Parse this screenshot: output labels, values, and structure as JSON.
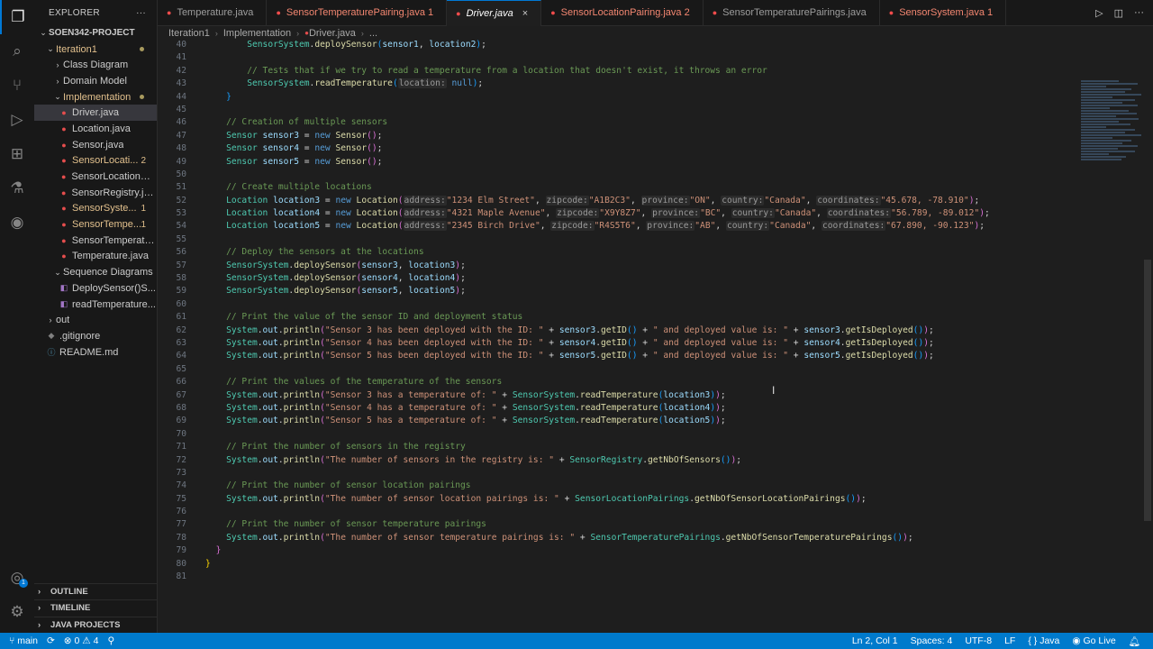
{
  "sidebar": {
    "title": "EXPLORER",
    "more": "···",
    "items": [
      {
        "label": "SOEN342-PROJECT",
        "chev": "⌄",
        "indent": 4,
        "bold": true,
        "cls": ""
      },
      {
        "label": "Iteration1",
        "chev": "⌄",
        "indent": 12,
        "cls": "mod",
        "dot": true
      },
      {
        "label": "Class Diagram",
        "chev": "›",
        "indent": 20,
        "cls": ""
      },
      {
        "label": "Domain Model",
        "chev": "›",
        "indent": 20,
        "cls": ""
      },
      {
        "label": "Implementation",
        "chev": "⌄",
        "indent": 20,
        "cls": "mod",
        "dot": true
      },
      {
        "label": "Driver.java",
        "icon": "java",
        "indent": 26,
        "cls": "",
        "selected": true
      },
      {
        "label": "Location.java",
        "icon": "java",
        "indent": 26,
        "cls": ""
      },
      {
        "label": "Sensor.java",
        "icon": "java",
        "indent": 26,
        "cls": ""
      },
      {
        "label": "SensorLocati...",
        "icon": "java",
        "indent": 26,
        "cls": "mod",
        "badge": "2"
      },
      {
        "label": "SensorLocationPa...",
        "icon": "java",
        "indent": 26,
        "cls": ""
      },
      {
        "label": "SensorRegistry.java",
        "icon": "java",
        "indent": 26,
        "cls": ""
      },
      {
        "label": "SensorSyste...",
        "icon": "java",
        "indent": 26,
        "cls": "mod",
        "badge": "1"
      },
      {
        "label": "SensorTempe...",
        "icon": "java",
        "indent": 26,
        "cls": "mod",
        "badge": "1"
      },
      {
        "label": "SensorTemperatu...",
        "icon": "java",
        "indent": 26,
        "cls": ""
      },
      {
        "label": "Temperature.java",
        "icon": "java",
        "indent": 26,
        "cls": ""
      },
      {
        "label": "Sequence Diagrams",
        "chev": "⌄",
        "indent": 20,
        "cls": ""
      },
      {
        "label": "DeploySensor()S...",
        "icon": "diagram",
        "indent": 26,
        "cls": ""
      },
      {
        "label": "readTemperature...",
        "icon": "diagram",
        "indent": 26,
        "cls": ""
      },
      {
        "label": "out",
        "chev": "›",
        "indent": 12,
        "cls": ""
      },
      {
        "label": ".gitignore",
        "icon": "git",
        "indent": 12,
        "cls": ""
      },
      {
        "label": "README.md",
        "icon": "info",
        "indent": 12,
        "cls": ""
      }
    ],
    "sections": [
      "OUTLINE",
      "TIMELINE",
      "JAVA PROJECTS"
    ]
  },
  "tabs": [
    {
      "label": "Temperature.java",
      "cls": ""
    },
    {
      "label": "SensorTemperaturePairing.java 1",
      "cls": "errt"
    },
    {
      "label": "Driver.java",
      "cls": "active"
    },
    {
      "label": "SensorLocationPairing.java 2",
      "cls": "errt"
    },
    {
      "label": "SensorTemperaturePairings.java",
      "cls": ""
    },
    {
      "label": "SensorSystem.java 1",
      "cls": "errt"
    }
  ],
  "breadcrumb": [
    "Iteration1",
    "Implementation",
    "Driver.java",
    "..."
  ],
  "code": [
    {
      "n": 40,
      "h": "        <span class='t'>SensorSystem</span><span class='p'>.</span><span class='f'>deploySensor</span><span class='b3'>(</span><span class='v'>sensor1</span><span class='p'>, </span><span class='v'>location2</span><span class='b3'>)</span><span class='p'>;</span>"
    },
    {
      "n": 41,
      "h": ""
    },
    {
      "n": 42,
      "h": "        <span class='c'>// Tests that if we try to read a temperature from a location that doesn't exist, it throws an error</span>"
    },
    {
      "n": 43,
      "h": "        <span class='t'>SensorSystem</span><span class='p'>.</span><span class='f'>readTemperature</span><span class='b3'>(</span><span class='hint'>location:</span> <span class='k'>null</span><span class='b3'>)</span><span class='p'>;</span>"
    },
    {
      "n": 44,
      "h": "    <span class='b3'>}</span>"
    },
    {
      "n": 45,
      "h": ""
    },
    {
      "n": 46,
      "h": "    <span class='c'>// Creation of multiple sensors</span>"
    },
    {
      "n": 47,
      "h": "    <span class='t'>Sensor</span> <span class='v'>sensor3</span> <span class='p'>=</span> <span class='k'>new</span> <span class='f'>Sensor</span><span class='b2'>()</span><span class='p'>;</span>"
    },
    {
      "n": 48,
      "h": "    <span class='t'>Sensor</span> <span class='v'>sensor4</span> <span class='p'>=</span> <span class='k'>new</span> <span class='f'>Sensor</span><span class='b2'>()</span><span class='p'>;</span>"
    },
    {
      "n": 49,
      "h": "    <span class='t'>Sensor</span> <span class='v'>sensor5</span> <span class='p'>=</span> <span class='k'>new</span> <span class='f'>Sensor</span><span class='b2'>()</span><span class='p'>;</span>"
    },
    {
      "n": 50,
      "h": ""
    },
    {
      "n": 51,
      "h": "    <span class='c'>// Create multiple locations</span>"
    },
    {
      "n": 52,
      "h": "    <span class='t'>Location</span> <span class='v'>location3</span> <span class='p'>=</span> <span class='k'>new</span> <span class='f'>Location</span><span class='b2'>(</span><span class='hint'>address:</span><span class='s'>\"1234 Elm Street\"</span><span class='p'>, </span><span class='hint'>zipcode:</span><span class='s'>\"A1B2C3\"</span><span class='p'>, </span><span class='hint'>province:</span><span class='s'>\"ON\"</span><span class='p'>, </span><span class='hint'>country:</span><span class='s'>\"Canada\"</span><span class='p'>, </span><span class='hint'>coordinates:</span><span class='s'>\"45.678, -78.910\"</span><span class='b2'>)</span><span class='p'>;</span>"
    },
    {
      "n": 53,
      "h": "    <span class='t'>Location</span> <span class='v'>location4</span> <span class='p'>=</span> <span class='k'>new</span> <span class='f'>Location</span><span class='b2'>(</span><span class='hint'>address:</span><span class='s'>\"4321 Maple Avenue\"</span><span class='p'>, </span><span class='hint'>zipcode:</span><span class='s'>\"X9Y8Z7\"</span><span class='p'>, </span><span class='hint'>province:</span><span class='s'>\"BC\"</span><span class='p'>, </span><span class='hint'>country:</span><span class='s'>\"Canada\"</span><span class='p'>, </span><span class='hint'>coordinates:</span><span class='s'>\"56.789, -89.012\"</span><span class='b2'>)</span><span class='p'>;</span>"
    },
    {
      "n": 54,
      "h": "    <span class='t'>Location</span> <span class='v'>location5</span> <span class='p'>=</span> <span class='k'>new</span> <span class='f'>Location</span><span class='b2'>(</span><span class='hint'>address:</span><span class='s'>\"2345 Birch Drive\"</span><span class='p'>, </span><span class='hint'>zipcode:</span><span class='s'>\"R4S5T6\"</span><span class='p'>, </span><span class='hint'>province:</span><span class='s'>\"AB\"</span><span class='p'>, </span><span class='hint'>country:</span><span class='s'>\"Canada\"</span><span class='p'>, </span><span class='hint'>coordinates:</span><span class='s'>\"67.890, -90.123\"</span><span class='b2'>)</span><span class='p'>;</span>"
    },
    {
      "n": 55,
      "h": ""
    },
    {
      "n": 56,
      "h": "    <span class='c'>// Deploy the sensors at the locations</span>"
    },
    {
      "n": 57,
      "h": "    <span class='t'>SensorSystem</span><span class='p'>.</span><span class='f'>deploySensor</span><span class='b2'>(</span><span class='v'>sensor3</span><span class='p'>, </span><span class='v'>location3</span><span class='b2'>)</span><span class='p'>;</span>"
    },
    {
      "n": 58,
      "h": "    <span class='t'>SensorSystem</span><span class='p'>.</span><span class='f'>deploySensor</span><span class='b2'>(</span><span class='v'>sensor4</span><span class='p'>, </span><span class='v'>location4</span><span class='b2'>)</span><span class='p'>;</span>"
    },
    {
      "n": 59,
      "h": "    <span class='t'>SensorSystem</span><span class='p'>.</span><span class='f'>deploySensor</span><span class='b2'>(</span><span class='v'>sensor5</span><span class='p'>, </span><span class='v'>location5</span><span class='b2'>)</span><span class='p'>;</span>"
    },
    {
      "n": 60,
      "h": ""
    },
    {
      "n": 61,
      "h": "    <span class='c'>// Print the value of the sensor ID and deployment status</span>"
    },
    {
      "n": 62,
      "h": "    <span class='t'>System</span><span class='p'>.</span><span class='v'>out</span><span class='p'>.</span><span class='f'>println</span><span class='b2'>(</span><span class='s'>\"Sensor 3 has been deployed with the ID: \"</span> <span class='p'>+</span> <span class='v'>sensor3</span><span class='p'>.</span><span class='f'>getID</span><span class='b3'>()</span> <span class='p'>+</span> <span class='s'>\" and deployed value is: \"</span> <span class='p'>+</span> <span class='v'>sensor3</span><span class='p'>.</span><span class='f'>getIsDeployed</span><span class='b3'>()</span><span class='b2'>)</span><span class='p'>;</span>"
    },
    {
      "n": 63,
      "h": "    <span class='t'>System</span><span class='p'>.</span><span class='v'>out</span><span class='p'>.</span><span class='f'>println</span><span class='b2'>(</span><span class='s'>\"Sensor 4 has been deployed with the ID: \"</span> <span class='p'>+</span> <span class='v'>sensor4</span><span class='p'>.</span><span class='f'>getID</span><span class='b3'>()</span> <span class='p'>+</span> <span class='s'>\" and deployed value is: \"</span> <span class='p'>+</span> <span class='v'>sensor4</span><span class='p'>.</span><span class='f'>getIsDeployed</span><span class='b3'>()</span><span class='b2'>)</span><span class='p'>;</span>"
    },
    {
      "n": 64,
      "h": "    <span class='t'>System</span><span class='p'>.</span><span class='v'>out</span><span class='p'>.</span><span class='f'>println</span><span class='b2'>(</span><span class='s'>\"Sensor 5 has been deployed with the ID: \"</span> <span class='p'>+</span> <span class='v'>sensor5</span><span class='p'>.</span><span class='f'>getID</span><span class='b3'>()</span> <span class='p'>+</span> <span class='s'>\" and deployed value is: \"</span> <span class='p'>+</span> <span class='v'>sensor5</span><span class='p'>.</span><span class='f'>getIsDeployed</span><span class='b3'>()</span><span class='b2'>)</span><span class='p'>;</span>"
    },
    {
      "n": 65,
      "h": ""
    },
    {
      "n": 66,
      "h": "    <span class='c'>// Print the values of the temperature of the sensors</span>"
    },
    {
      "n": 67,
      "h": "    <span class='t'>System</span><span class='p'>.</span><span class='v'>out</span><span class='p'>.</span><span class='f'>println</span><span class='b2'>(</span><span class='s'>\"Sensor 3 has a temperature of: \"</span> <span class='p'>+</span> <span class='t'>SensorSystem</span><span class='p'>.</span><span class='f'>readTemperature</span><span class='b3'>(</span><span class='v'>location3</span><span class='b3'>)</span><span class='b2'>)</span><span class='p'>;</span>"
    },
    {
      "n": 68,
      "h": "    <span class='t'>System</span><span class='p'>.</span><span class='v'>out</span><span class='p'>.</span><span class='f'>println</span><span class='b2'>(</span><span class='s'>\"Sensor 4 has a temperature of: \"</span> <span class='p'>+</span> <span class='t'>SensorSystem</span><span class='p'>.</span><span class='f'>readTemperature</span><span class='b3'>(</span><span class='v'>location4</span><span class='b3'>)</span><span class='b2'>)</span><span class='p'>;</span>"
    },
    {
      "n": 69,
      "h": "    <span class='t'>System</span><span class='p'>.</span><span class='v'>out</span><span class='p'>.</span><span class='f'>println</span><span class='b2'>(</span><span class='s'>\"Sensor 5 has a temperature of: \"</span> <span class='p'>+</span> <span class='t'>SensorSystem</span><span class='p'>.</span><span class='f'>readTemperature</span><span class='b3'>(</span><span class='v'>location5</span><span class='b3'>)</span><span class='b2'>)</span><span class='p'>;</span>"
    },
    {
      "n": 70,
      "h": ""
    },
    {
      "n": 71,
      "h": "    <span class='c'>// Print the number of sensors in the registry</span>"
    },
    {
      "n": 72,
      "h": "    <span class='t'>System</span><span class='p'>.</span><span class='v'>out</span><span class='p'>.</span><span class='f'>println</span><span class='b2'>(</span><span class='s'>\"The number of sensors in the registry is: \"</span> <span class='p'>+</span> <span class='t'>SensorRegistry</span><span class='p'>.</span><span class='f'>getNbOfSensors</span><span class='b3'>()</span><span class='b2'>)</span><span class='p'>;</span>"
    },
    {
      "n": 73,
      "h": ""
    },
    {
      "n": 74,
      "h": "    <span class='c'>// Print the number of sensor location pairings</span>"
    },
    {
      "n": 75,
      "h": "    <span class='t'>System</span><span class='p'>.</span><span class='v'>out</span><span class='p'>.</span><span class='f'>println</span><span class='b2'>(</span><span class='s'>\"The number of sensor location pairings is: \"</span> <span class='p'>+</span> <span class='t'>SensorLocationPairings</span><span class='p'>.</span><span class='f'>getNbOfSensorLocationPairings</span><span class='b3'>()</span><span class='b2'>)</span><span class='p'>;</span>"
    },
    {
      "n": 76,
      "h": ""
    },
    {
      "n": 77,
      "h": "    <span class='c'>// Print the number of sensor temperature pairings</span>"
    },
    {
      "n": 78,
      "h": "    <span class='t'>System</span><span class='p'>.</span><span class='v'>out</span><span class='p'>.</span><span class='f'>println</span><span class='b2'>(</span><span class='s'>\"The number of sensor temperature pairings is: \"</span> <span class='p'>+</span> <span class='t'>SensorTemperaturePairings</span><span class='p'>.</span><span class='f'>getNbOfSensorTemperaturePairings</span><span class='b3'>()</span><span class='b2'>)</span><span class='p'>;</span>"
    },
    {
      "n": 79,
      "h": "  <span class='b2'>}</span>"
    },
    {
      "n": 80,
      "h": "<span class='b1'>}</span>"
    },
    {
      "n": 81,
      "h": ""
    }
  ],
  "status": {
    "branch": "main",
    "errors": "0",
    "warnings": "4",
    "position": "Ln 2, Col 1",
    "spaces": "Spaces: 4",
    "encoding": "UTF-8",
    "eol": "LF",
    "language": "Java",
    "golive": "Go Live"
  },
  "colors": {
    "accent": "#0078d4",
    "status_bar": "#007acc"
  }
}
